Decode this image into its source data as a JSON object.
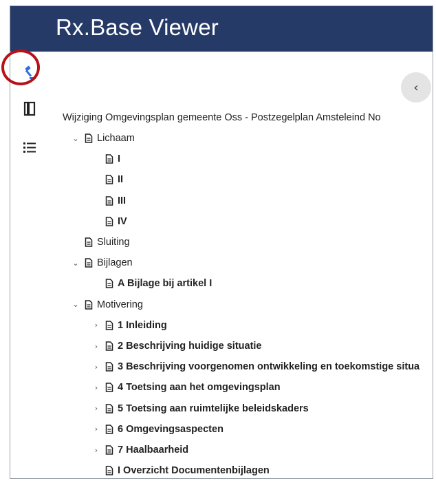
{
  "app": {
    "title": "Rx.Base Viewer"
  },
  "rail": {
    "items": [
      {
        "icon": "gavel-icon",
        "active": true
      },
      {
        "icon": "book-icon"
      },
      {
        "icon": "list-icon"
      }
    ]
  },
  "panel": {
    "collapse_symbol": "‹"
  },
  "tree": {
    "document_title": "Wijziging Omgevingsplan gemeente Oss - Postzegelplan Amsteleind No",
    "nodes": [
      {
        "label": "Lichaam",
        "level": 1,
        "expander": "expanded",
        "bold": false
      },
      {
        "label": "I",
        "level": 2,
        "expander": "none",
        "bold": true
      },
      {
        "label": "II",
        "level": 2,
        "expander": "none",
        "bold": true
      },
      {
        "label": "III",
        "level": 2,
        "expander": "none",
        "bold": true
      },
      {
        "label": "IV",
        "level": 2,
        "expander": "none",
        "bold": true
      },
      {
        "label": "Sluiting",
        "level": 1,
        "expander": "none",
        "bold": false
      },
      {
        "label": "Bijlagen",
        "level": 1,
        "expander": "expanded",
        "bold": false
      },
      {
        "label": "A Bijlage bij artikel I",
        "level": 2,
        "expander": "none",
        "bold": true
      },
      {
        "label": "Motivering",
        "level": 1,
        "expander": "expanded",
        "bold": false
      },
      {
        "label": "1 Inleiding",
        "level": 2,
        "expander": "collapsed",
        "bold": true
      },
      {
        "label": "2 Beschrijving huidige situatie",
        "level": 2,
        "expander": "collapsed",
        "bold": true
      },
      {
        "label": "3 Beschrijving voorgenomen ontwikkeling en toekomstige situa",
        "level": 2,
        "expander": "collapsed",
        "bold": true
      },
      {
        "label": "4 Toetsing aan het omgevingsplan",
        "level": 2,
        "expander": "collapsed",
        "bold": true
      },
      {
        "label": "5 Toetsing aan ruimtelijke beleidskaders",
        "level": 2,
        "expander": "collapsed",
        "bold": true
      },
      {
        "label": "6 Omgevingsaspecten",
        "level": 2,
        "expander": "collapsed",
        "bold": true
      },
      {
        "label": "7 Haalbaarheid",
        "level": 2,
        "expander": "collapsed",
        "bold": true
      },
      {
        "label": "I Overzicht Documentenbijlagen",
        "level": 2,
        "expander": "none",
        "bold": true
      }
    ]
  },
  "colors": {
    "header": "#263a67",
    "highlight": "#b5121b",
    "active_icon": "#2f6fd6"
  }
}
